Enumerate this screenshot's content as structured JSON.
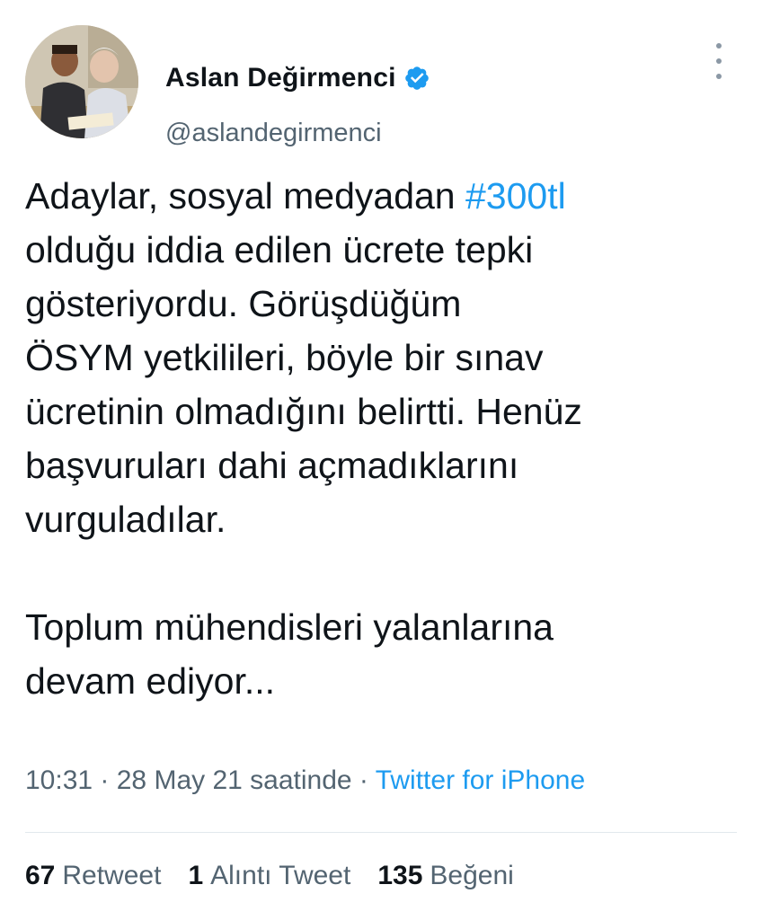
{
  "tweet": {
    "author": {
      "name": "Aslan Değirmenci",
      "handle": "@aslandegirmenci",
      "verified": true
    },
    "text_before_hashtag": "Adaylar, sosyal medyadan ",
    "hashtag": "#300tl",
    "text_after_hashtag": "\nolduğu iddia edilen ücrete tepki\ngösteriyordu. Görüşdüğüm\nÖSYM yetkilileri, böyle bir sınav\nücretinin olmadığını belirtti. Henüz\nbaşvuruları dahi açmadıklarını\nvurguladılar.\n\nToplum mühendisleri yalanlarına\ndevam ediyor...",
    "meta": {
      "time": "10:31",
      "separator": " · ",
      "date": "28 May 21 saatinde",
      "source": "Twitter for iPhone"
    },
    "stats": {
      "retweet_count": "67",
      "retweet_label": "Retweet",
      "quote_count": "1",
      "quote_label": "Alıntı Tweet",
      "like_count": "135",
      "like_label": "Beğeni"
    }
  },
  "colors": {
    "link": "#1d9bf0",
    "secondary_text": "#536471",
    "primary_text": "#0f1419"
  },
  "icons": {
    "verified": "verified-badge-icon",
    "more": "more-vertical-icon"
  }
}
